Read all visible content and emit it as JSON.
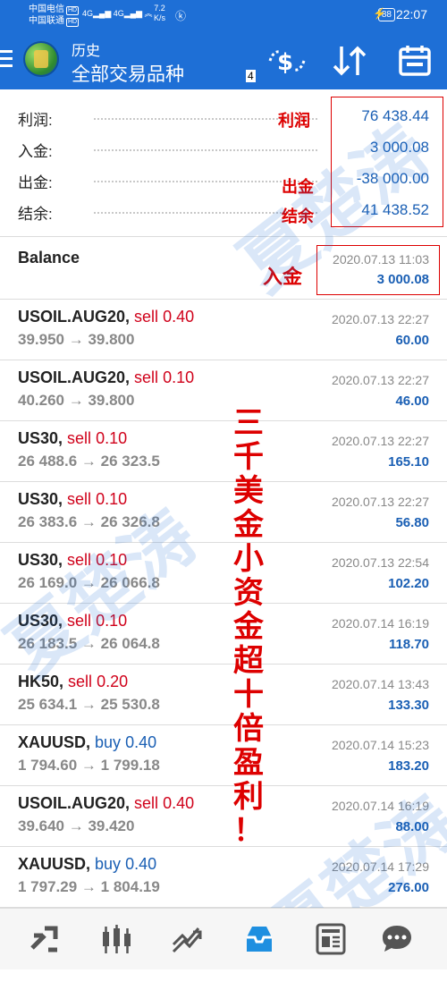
{
  "status_bar": {
    "carrier1": "中国电信",
    "carrier2": "中国联通",
    "hd": "HD",
    "signal": "4G",
    "net_speed": "7.2",
    "net_unit": "K/s",
    "battery": "88",
    "time": "22:07"
  },
  "toolbar": {
    "title_top": "历史",
    "title_main": "全部交易品种",
    "badge": "4"
  },
  "summary": [
    {
      "label": "利润:",
      "value": "76 438.44"
    },
    {
      "label": "入金:",
      "value": "3 000.08"
    },
    {
      "label": "出金:",
      "value": "-38 000.00"
    },
    {
      "label": "结余:",
      "value": "41 438.52"
    }
  ],
  "annotations": {
    "profit": "利润",
    "withdraw": "出金",
    "balance": "结余",
    "deposit": "入金",
    "slogan": [
      "三",
      "千",
      "美",
      "金",
      "小",
      "资",
      "金",
      "超",
      "十",
      "倍",
      "盈",
      "利",
      "！"
    ],
    "watermark": "夏楚涛"
  },
  "balance_row": {
    "label": "Balance",
    "date": "2020.07.13 11:03",
    "amount": "3 000.08"
  },
  "trades": [
    {
      "symbol": "USOIL.AUG20,",
      "side": "sell",
      "lots": "0.40",
      "open": "39.950",
      "close": "39.800",
      "date": "2020.07.13 22:27",
      "profit": "60.00"
    },
    {
      "symbol": "USOIL.AUG20,",
      "side": "sell",
      "lots": "0.10",
      "open": "40.260",
      "close": "39.800",
      "date": "2020.07.13 22:27",
      "profit": "46.00"
    },
    {
      "symbol": "US30,",
      "side": "sell",
      "lots": "0.10",
      "open": "26 488.6",
      "close": "26 323.5",
      "date": "2020.07.13 22:27",
      "profit": "165.10"
    },
    {
      "symbol": "US30,",
      "side": "sell",
      "lots": "0.10",
      "open": "26 383.6",
      "close": "26 326.8",
      "date": "2020.07.13 22:27",
      "profit": "56.80"
    },
    {
      "symbol": "US30,",
      "side": "sell",
      "lots": "0.10",
      "open": "26 169.0",
      "close": "26 066.8",
      "date": "2020.07.13 22:54",
      "profit": "102.20"
    },
    {
      "symbol": "US30,",
      "side": "sell",
      "lots": "0.10",
      "open": "26 183.5",
      "close": "26 064.8",
      "date": "2020.07.14 16:19",
      "profit": "118.70"
    },
    {
      "symbol": "HK50,",
      "side": "sell",
      "lots": "0.20",
      "open": "25 634.1",
      "close": "25 530.8",
      "date": "2020.07.14 13:43",
      "profit": "133.30"
    },
    {
      "symbol": "XAUUSD,",
      "side": "buy",
      "lots": "0.40",
      "open": "1 794.60",
      "close": "1 799.18",
      "date": "2020.07.14 15:23",
      "profit": "183.20"
    },
    {
      "symbol": "USOIL.AUG20,",
      "side": "sell",
      "lots": "0.40",
      "open": "39.640",
      "close": "39.420",
      "date": "2020.07.14 16:19",
      "profit": "88.00"
    },
    {
      "symbol": "XAUUSD,",
      "side": "buy",
      "lots": "0.40",
      "open": "1 797.29",
      "close": "1 804.19",
      "date": "2020.07.14 17:29",
      "profit": "276.00"
    }
  ],
  "arrow": "→",
  "colors": {
    "accent": "#1e6fd6",
    "sell": "#d0021b",
    "buy": "#1a5fb4",
    "profit": "#1a5fb4",
    "annotation": "#dd0000"
  },
  "bottom_nav": [
    {
      "icon": "quotes-icon"
    },
    {
      "icon": "chart-icon"
    },
    {
      "icon": "trade-icon"
    },
    {
      "icon": "history-icon"
    },
    {
      "icon": "news-icon"
    },
    {
      "icon": "chat-icon"
    }
  ]
}
